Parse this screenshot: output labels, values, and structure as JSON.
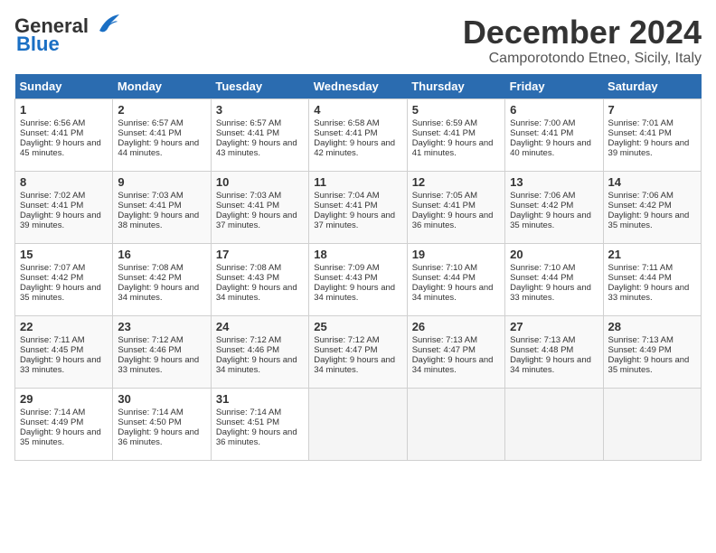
{
  "logo": {
    "line1": "General",
    "line2": "Blue"
  },
  "title": "December 2024",
  "location": "Camporotondo Etneo, Sicily, Italy",
  "days_of_week": [
    "Sunday",
    "Monday",
    "Tuesday",
    "Wednesday",
    "Thursday",
    "Friday",
    "Saturday"
  ],
  "weeks": [
    [
      {
        "day": "1",
        "sunrise": "Sunrise: 6:56 AM",
        "sunset": "Sunset: 4:41 PM",
        "daylight": "Daylight: 9 hours and 45 minutes."
      },
      {
        "day": "2",
        "sunrise": "Sunrise: 6:57 AM",
        "sunset": "Sunset: 4:41 PM",
        "daylight": "Daylight: 9 hours and 44 minutes."
      },
      {
        "day": "3",
        "sunrise": "Sunrise: 6:57 AM",
        "sunset": "Sunset: 4:41 PM",
        "daylight": "Daylight: 9 hours and 43 minutes."
      },
      {
        "day": "4",
        "sunrise": "Sunrise: 6:58 AM",
        "sunset": "Sunset: 4:41 PM",
        "daylight": "Daylight: 9 hours and 42 minutes."
      },
      {
        "day": "5",
        "sunrise": "Sunrise: 6:59 AM",
        "sunset": "Sunset: 4:41 PM",
        "daylight": "Daylight: 9 hours and 41 minutes."
      },
      {
        "day": "6",
        "sunrise": "Sunrise: 7:00 AM",
        "sunset": "Sunset: 4:41 PM",
        "daylight": "Daylight: 9 hours and 40 minutes."
      },
      {
        "day": "7",
        "sunrise": "Sunrise: 7:01 AM",
        "sunset": "Sunset: 4:41 PM",
        "daylight": "Daylight: 9 hours and 39 minutes."
      }
    ],
    [
      {
        "day": "8",
        "sunrise": "Sunrise: 7:02 AM",
        "sunset": "Sunset: 4:41 PM",
        "daylight": "Daylight: 9 hours and 39 minutes."
      },
      {
        "day": "9",
        "sunrise": "Sunrise: 7:03 AM",
        "sunset": "Sunset: 4:41 PM",
        "daylight": "Daylight: 9 hours and 38 minutes."
      },
      {
        "day": "10",
        "sunrise": "Sunrise: 7:03 AM",
        "sunset": "Sunset: 4:41 PM",
        "daylight": "Daylight: 9 hours and 37 minutes."
      },
      {
        "day": "11",
        "sunrise": "Sunrise: 7:04 AM",
        "sunset": "Sunset: 4:41 PM",
        "daylight": "Daylight: 9 hours and 37 minutes."
      },
      {
        "day": "12",
        "sunrise": "Sunrise: 7:05 AM",
        "sunset": "Sunset: 4:41 PM",
        "daylight": "Daylight: 9 hours and 36 minutes."
      },
      {
        "day": "13",
        "sunrise": "Sunrise: 7:06 AM",
        "sunset": "Sunset: 4:42 PM",
        "daylight": "Daylight: 9 hours and 35 minutes."
      },
      {
        "day": "14",
        "sunrise": "Sunrise: 7:06 AM",
        "sunset": "Sunset: 4:42 PM",
        "daylight": "Daylight: 9 hours and 35 minutes."
      }
    ],
    [
      {
        "day": "15",
        "sunrise": "Sunrise: 7:07 AM",
        "sunset": "Sunset: 4:42 PM",
        "daylight": "Daylight: 9 hours and 35 minutes."
      },
      {
        "day": "16",
        "sunrise": "Sunrise: 7:08 AM",
        "sunset": "Sunset: 4:42 PM",
        "daylight": "Daylight: 9 hours and 34 minutes."
      },
      {
        "day": "17",
        "sunrise": "Sunrise: 7:08 AM",
        "sunset": "Sunset: 4:43 PM",
        "daylight": "Daylight: 9 hours and 34 minutes."
      },
      {
        "day": "18",
        "sunrise": "Sunrise: 7:09 AM",
        "sunset": "Sunset: 4:43 PM",
        "daylight": "Daylight: 9 hours and 34 minutes."
      },
      {
        "day": "19",
        "sunrise": "Sunrise: 7:10 AM",
        "sunset": "Sunset: 4:44 PM",
        "daylight": "Daylight: 9 hours and 34 minutes."
      },
      {
        "day": "20",
        "sunrise": "Sunrise: 7:10 AM",
        "sunset": "Sunset: 4:44 PM",
        "daylight": "Daylight: 9 hours and 33 minutes."
      },
      {
        "day": "21",
        "sunrise": "Sunrise: 7:11 AM",
        "sunset": "Sunset: 4:44 PM",
        "daylight": "Daylight: 9 hours and 33 minutes."
      }
    ],
    [
      {
        "day": "22",
        "sunrise": "Sunrise: 7:11 AM",
        "sunset": "Sunset: 4:45 PM",
        "daylight": "Daylight: 9 hours and 33 minutes."
      },
      {
        "day": "23",
        "sunrise": "Sunrise: 7:12 AM",
        "sunset": "Sunset: 4:46 PM",
        "daylight": "Daylight: 9 hours and 33 minutes."
      },
      {
        "day": "24",
        "sunrise": "Sunrise: 7:12 AM",
        "sunset": "Sunset: 4:46 PM",
        "daylight": "Daylight: 9 hours and 34 minutes."
      },
      {
        "day": "25",
        "sunrise": "Sunrise: 7:12 AM",
        "sunset": "Sunset: 4:47 PM",
        "daylight": "Daylight: 9 hours and 34 minutes."
      },
      {
        "day": "26",
        "sunrise": "Sunrise: 7:13 AM",
        "sunset": "Sunset: 4:47 PM",
        "daylight": "Daylight: 9 hours and 34 minutes."
      },
      {
        "day": "27",
        "sunrise": "Sunrise: 7:13 AM",
        "sunset": "Sunset: 4:48 PM",
        "daylight": "Daylight: 9 hours and 34 minutes."
      },
      {
        "day": "28",
        "sunrise": "Sunrise: 7:13 AM",
        "sunset": "Sunset: 4:49 PM",
        "daylight": "Daylight: 9 hours and 35 minutes."
      }
    ],
    [
      {
        "day": "29",
        "sunrise": "Sunrise: 7:14 AM",
        "sunset": "Sunset: 4:49 PM",
        "daylight": "Daylight: 9 hours and 35 minutes."
      },
      {
        "day": "30",
        "sunrise": "Sunrise: 7:14 AM",
        "sunset": "Sunset: 4:50 PM",
        "daylight": "Daylight: 9 hours and 36 minutes."
      },
      {
        "day": "31",
        "sunrise": "Sunrise: 7:14 AM",
        "sunset": "Sunset: 4:51 PM",
        "daylight": "Daylight: 9 hours and 36 minutes."
      },
      null,
      null,
      null,
      null
    ]
  ]
}
